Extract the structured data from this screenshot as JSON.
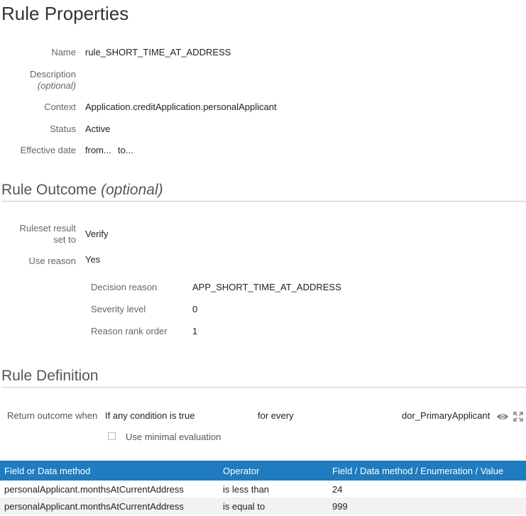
{
  "rule_properties": {
    "title": "Rule Properties",
    "name_label": "Name",
    "name_value": "rule_SHORT_TIME_AT_ADDRESS",
    "description_label": "Description",
    "description_optional": "(optional)",
    "context_label": "Context",
    "context_value": "Application.creditApplication.personalApplicant",
    "status_label": "Status",
    "status_value": "Active",
    "effective_label": "Effective date",
    "effective_from": "from...",
    "effective_to": "to..."
  },
  "rule_outcome": {
    "title": "Rule Outcome",
    "title_optional": "(optional)",
    "ruleset_label_line1": "Ruleset result",
    "ruleset_label_line2": "set to",
    "ruleset_value": "Verify",
    "use_reason_label": "Use reason",
    "use_reason_value": "Yes",
    "decision_reason_label": "Decision reason",
    "decision_reason_value": "APP_SHORT_TIME_AT_ADDRESS",
    "severity_label": "Severity level",
    "severity_value": "0",
    "rank_label": "Reason rank order",
    "rank_value": "1"
  },
  "rule_definition": {
    "title": "Rule Definition",
    "return_label": "Return outcome when",
    "condition_mode": "If any condition is true",
    "for_every": "for every",
    "target": "dor_PrimaryApplicant",
    "minimal_eval_label": "Use minimal evaluation",
    "minimal_eval_checked": false,
    "icons": [
      "eye-icon",
      "expand-icon"
    ]
  },
  "conditions": {
    "headers": [
      "Field or Data method",
      "Operator",
      "Field / Data method / Enumeration / Value"
    ],
    "rows": [
      [
        "personalApplicant.monthsAtCurrentAddress",
        "is less than",
        "24"
      ],
      [
        "personalApplicant.monthsAtCurrentAddress",
        "is equal to",
        "999"
      ]
    ],
    "header_color": "#1f7cc1",
    "alt_row_color": "#f2f2f2"
  }
}
